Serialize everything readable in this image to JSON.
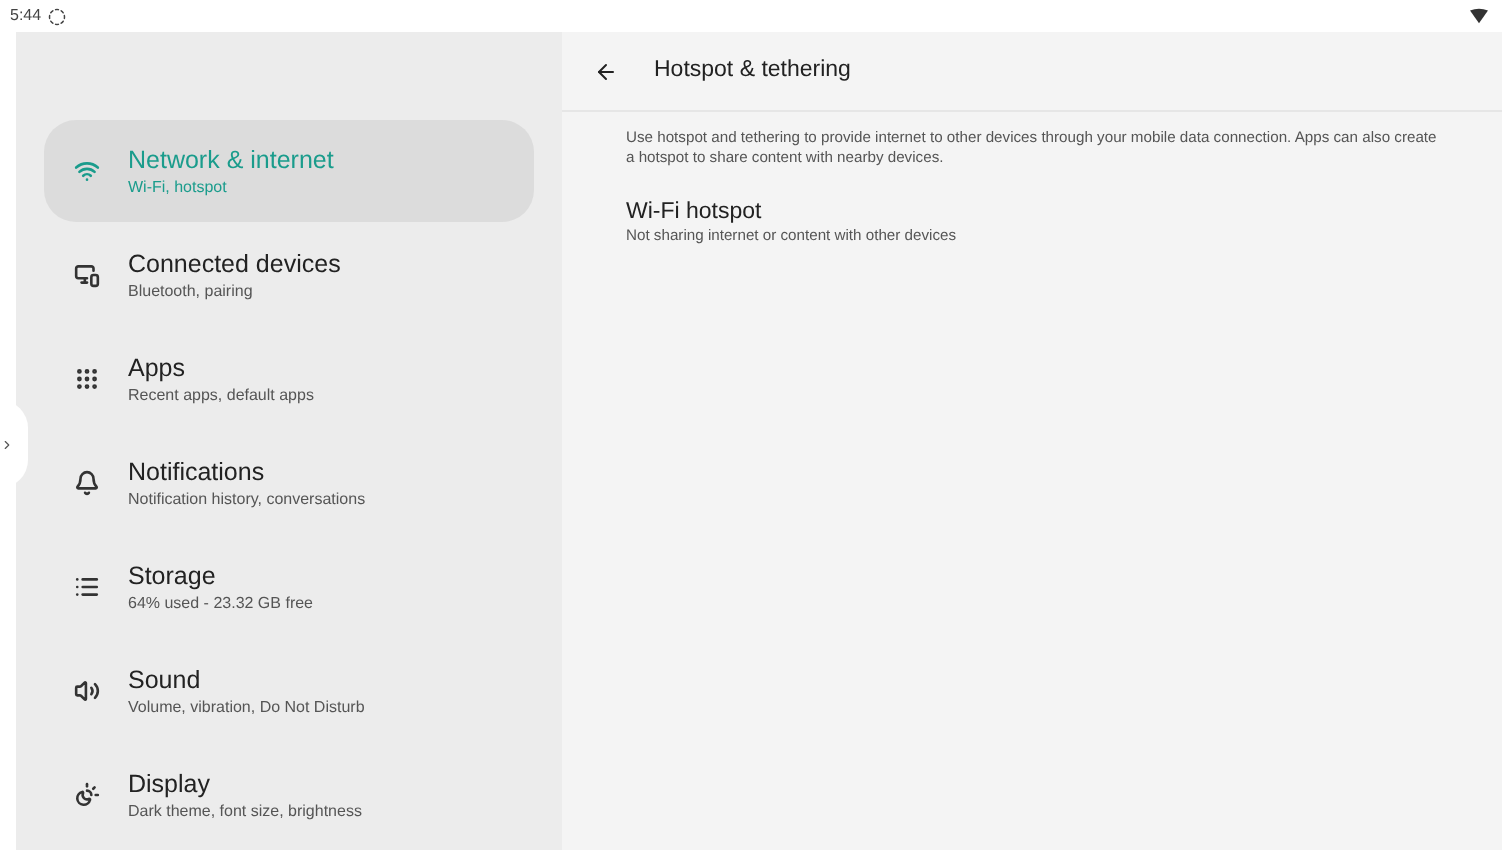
{
  "status_bar": {
    "time": "5:44"
  },
  "sidebar": {
    "items": [
      {
        "kind": "network",
        "title": "Network & internet",
        "subtitle": "Wi-Fi, hotspot",
        "selected": true
      },
      {
        "kind": "devices",
        "title": "Connected devices",
        "subtitle": "Bluetooth, pairing",
        "selected": false
      },
      {
        "kind": "apps",
        "title": "Apps",
        "subtitle": "Recent apps, default apps",
        "selected": false
      },
      {
        "kind": "notifications",
        "title": "Notifications",
        "subtitle": "Notification history, conversations",
        "selected": false
      },
      {
        "kind": "storage",
        "title": "Storage",
        "subtitle": "64% used - 23.32 GB free",
        "selected": false
      },
      {
        "kind": "sound",
        "title": "Sound",
        "subtitle": "Volume, vibration, Do Not Disturb",
        "selected": false
      },
      {
        "kind": "display",
        "title": "Display",
        "subtitle": "Dark theme, font size, brightness",
        "selected": false
      }
    ]
  },
  "detail": {
    "title": "Hotspot & tethering",
    "description": "Use hotspot and tethering to provide internet to other devices through your mobile data connection. Apps can also create a hotspot to share content with nearby devices.",
    "items": [
      {
        "title": "Wi-Fi hotspot",
        "subtitle": "Not sharing internet or content with other devices"
      }
    ]
  }
}
